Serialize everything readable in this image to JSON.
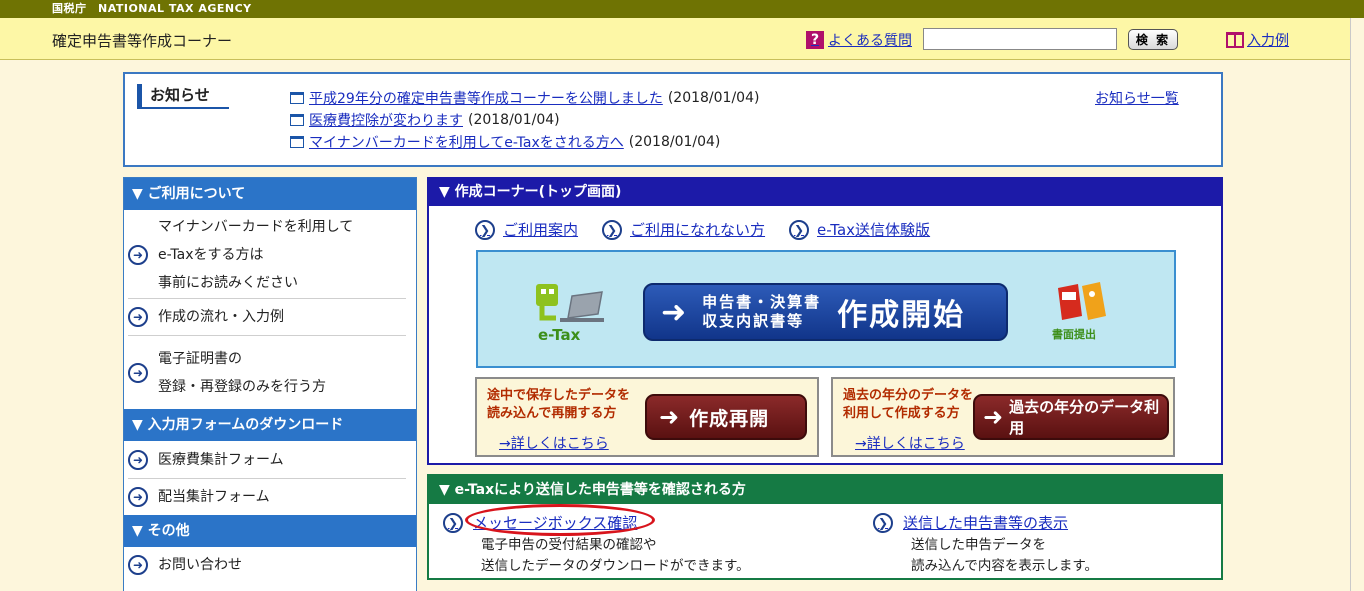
{
  "header": {
    "agency": "国税庁　NATIONAL TAX AGENCY",
    "site_title": "確定申告書等作成コーナー",
    "faq_label": "よくある質問",
    "search_value": "",
    "search_button": "検 索",
    "example_label": "入力例"
  },
  "notices": {
    "heading": "お知らせ",
    "items": [
      {
        "link": "平成29年分の確定申告書等作成コーナーを公開しました",
        "date": "(2018/01/04)"
      },
      {
        "link": "医療費控除が変わります",
        "date": "(2018/01/04)"
      },
      {
        "link": "マイナンバーカードを利用してe-Taxをされる方へ",
        "date": "(2018/01/04)"
      }
    ],
    "list_link": "お知らせ一覧"
  },
  "sidebar": {
    "sections": [
      {
        "heading": "▼ ご利用について",
        "items": [
          {
            "lines": [
              "マイナンバーカードを利用して",
              "e-Taxをする方は",
              "事前にお読みください"
            ]
          },
          {
            "lines": [
              "作成の流れ・入力例"
            ]
          },
          {
            "lines": [
              "電子証明書の",
              "登録・再登録のみを行う方"
            ]
          }
        ]
      },
      {
        "heading": "▼ 入力用フォームのダウンロード",
        "items": [
          {
            "lines": [
              "医療費集計フォーム"
            ]
          },
          {
            "lines": [
              "配当集計フォーム"
            ]
          }
        ]
      },
      {
        "heading": "▼ その他",
        "items": [
          {
            "lines": [
              "お問い合わせ"
            ]
          }
        ]
      }
    ]
  },
  "corner": {
    "heading": "▼ 作成コーナー(トップ画面)",
    "links": [
      "ご利用案内",
      "ご利用になれない方",
      "e-Tax送信体験版"
    ],
    "etax_label": "e-Tax",
    "start_sub_1": "申告書・決算書",
    "start_sub_2": "収支内訳書等",
    "start_main": "作成開始",
    "paper_label": "書面提出",
    "resume": {
      "desc_1": "途中で保存したデータを",
      "desc_2": "読み込んで再開する方",
      "more": "→詳しくはこちら",
      "button": "作成再開"
    },
    "past": {
      "desc_1": "過去の年分のデータを",
      "desc_2": "利用して作成する方",
      "more": "→詳しくはこちら",
      "button": "過去の年分のデータ利用"
    }
  },
  "confirm": {
    "heading": "▼ e-Taxにより送信した申告書等を確認される方",
    "left": {
      "link": "メッセージボックス確認",
      "desc_1": "電子申告の受付結果の確認や",
      "desc_2": "送信したデータのダウンロードができます。"
    },
    "right": {
      "link": "送信した申告書等の表示",
      "desc_1": "送信した申告データを",
      "desc_2": "読み込んで内容を表示します。"
    }
  },
  "colors": {
    "agency_bar": "#6f7303",
    "title_bar": "#fdf7a6",
    "sidebar_head": "#2b74c8",
    "corner_head": "#1c1aa8",
    "confirm_head": "#157a44",
    "highlight_oval": "#d8141c"
  }
}
